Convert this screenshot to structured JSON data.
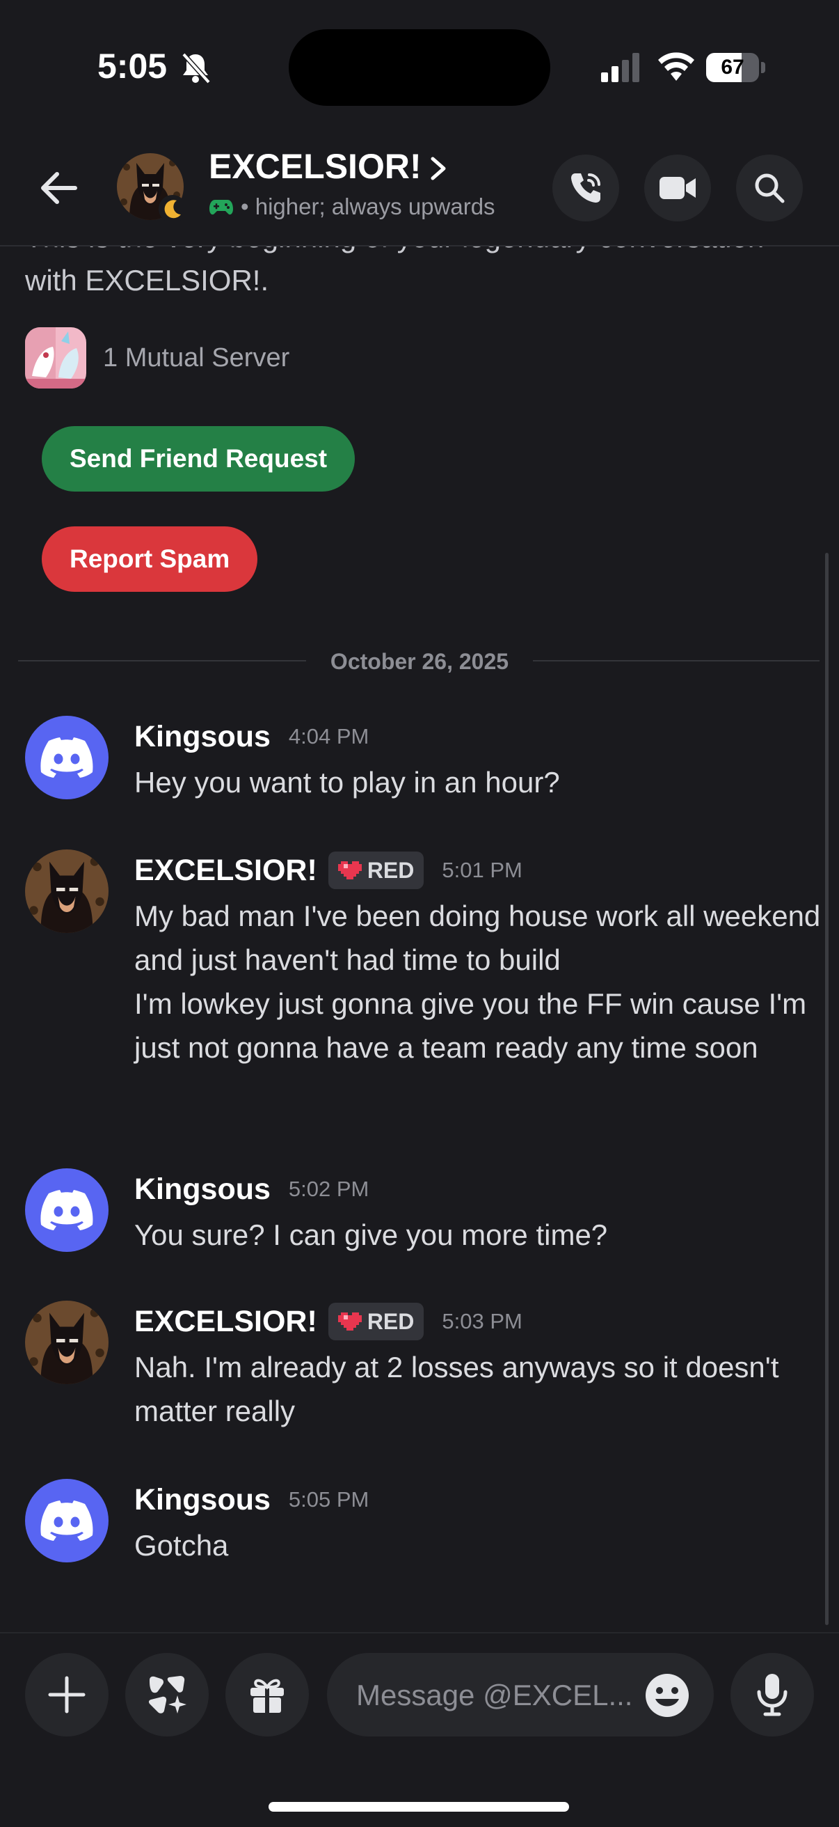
{
  "status_bar": {
    "time": "5:05",
    "battery": "67",
    "battery_level": 0.67
  },
  "header": {
    "title": "EXCELSIOR!",
    "status_text": "• higher; always upwards",
    "icons": [
      "back-arrow-icon",
      "chevron-right-icon",
      "game-controller-icon",
      "phone-call-icon",
      "video-camera-icon",
      "search-icon",
      "moon-icon"
    ]
  },
  "intro": {
    "text": "This is the very beginning of your legendary conversation with EXCELSIOR!.",
    "mutual_servers": "1 Mutual Server"
  },
  "actions": {
    "friend_request": "Send Friend Request",
    "report_spam": "Report Spam"
  },
  "date_divider": "October 26, 2025",
  "messages": [
    {
      "author": "Kingsous",
      "time": "4:04 PM",
      "lines": [
        "Hey you want to play in an hour?"
      ]
    },
    {
      "author": "EXCELSIOR!",
      "badge": "RED",
      "time": "5:01 PM",
      "lines": [
        "My bad man I've been doing house work all weekend and just haven't had time to build",
        "I'm lowkey just gonna give you the FF win cause I'm just not gonna have a team ready any time soon"
      ]
    },
    {
      "author": "Kingsous",
      "time": "5:02 PM",
      "lines": [
        "You sure? I can give you more time?"
      ]
    },
    {
      "author": "EXCELSIOR!",
      "badge": "RED",
      "time": "5:03 PM",
      "lines": [
        "Nah. I'm already at 2 losses anyways so it doesn't matter really"
      ]
    },
    {
      "author": "Kingsous",
      "time": "5:05 PM",
      "lines": [
        "Gotcha"
      ]
    }
  ],
  "composer": {
    "placeholder": "Message @EXCEL...",
    "icons": [
      "plus-icon",
      "apps-icon",
      "gift-icon",
      "emoji-icon",
      "microphone-icon"
    ]
  },
  "colors": {
    "background": "#1a1a1e",
    "blurple": "#5865f2",
    "green": "#248046",
    "red": "#da373c",
    "status_green": "#23a55a"
  }
}
